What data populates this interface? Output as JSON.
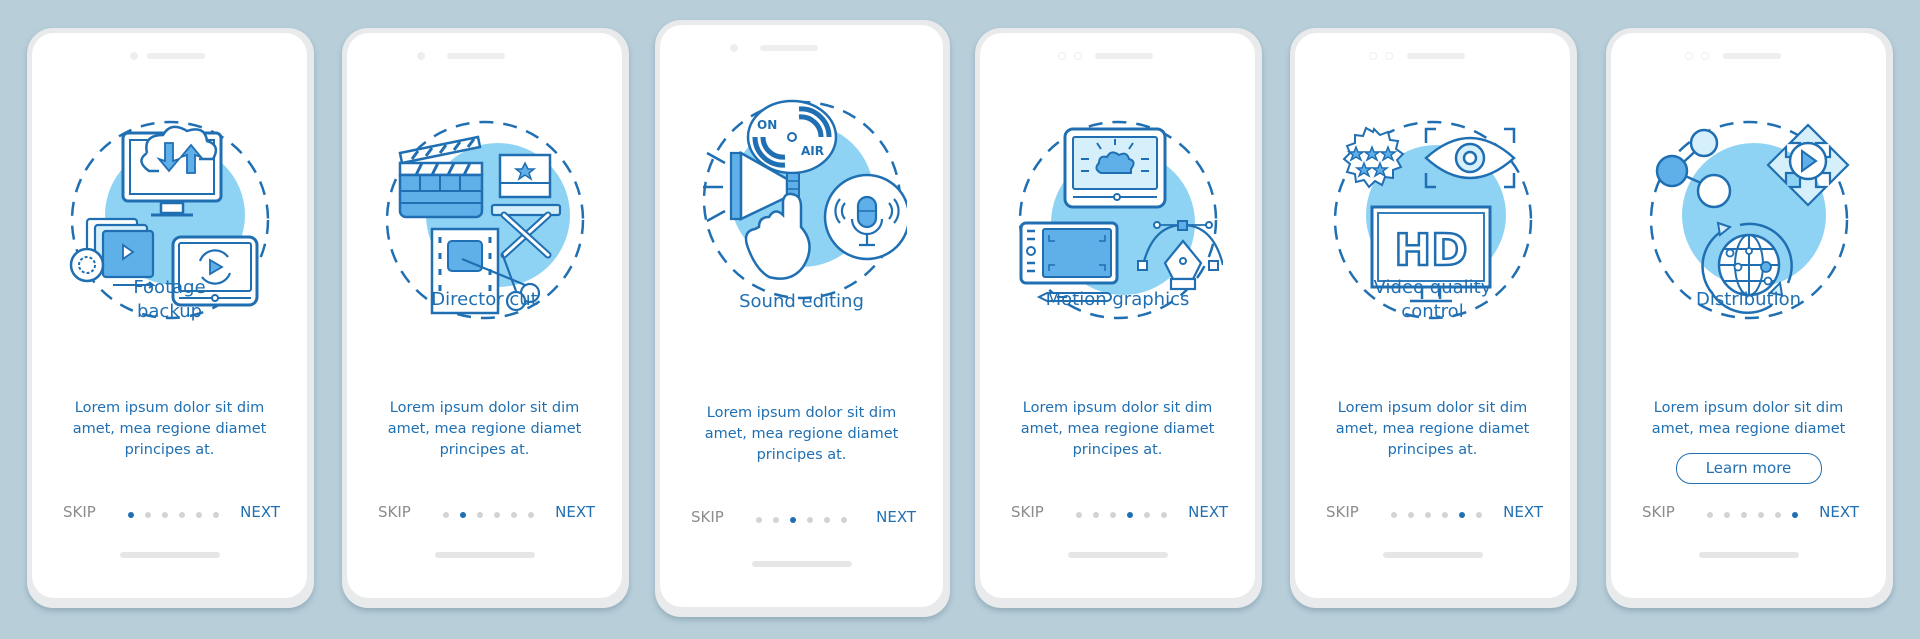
{
  "colors": {
    "background": "#b8cfda",
    "accent": "#1f6fb2",
    "icon_fill_light": "#8fd3f4",
    "icon_fill_mid": "#5fb0e8",
    "muted": "#8c8c8c"
  },
  "common": {
    "skip_label": "SKIP",
    "next_label": "NEXT",
    "description": "Lorem ipsum dolor sit dim amet, mea regione diamet principes at.",
    "description_short": "Lorem ipsum dolor sit dim amet, mea regione diamet"
  },
  "screens": [
    {
      "title": "Footage\nbackup",
      "illustration": "footage-backup-icon",
      "page_index": 1,
      "page_count": 6
    },
    {
      "title": "Director cut",
      "illustration": "director-cut-icon",
      "page_index": 2,
      "page_count": 6
    },
    {
      "title": "Sound editing",
      "illustration": "sound-editing-icon",
      "page_index": 3,
      "page_count": 6
    },
    {
      "title": "Motion graphics",
      "illustration": "motion-graphics-icon",
      "page_index": 4,
      "page_count": 6
    },
    {
      "title": "Video quality\ncontrol",
      "illustration": "video-quality-control-icon",
      "page_index": 5,
      "page_count": 6
    },
    {
      "title": "Distribution",
      "illustration": "distribution-icon",
      "page_index": 6,
      "page_count": 6,
      "button_label": "Learn more"
    }
  ],
  "icon_text": {
    "on_air_top": "ON",
    "on_air_bottom": "AIR",
    "hd": "HD"
  }
}
